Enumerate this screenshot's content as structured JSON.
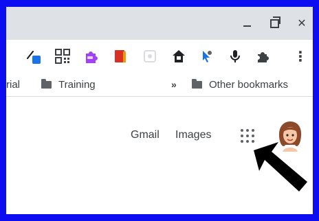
{
  "window": {
    "controls": [
      {
        "name": "minimize-icon"
      },
      {
        "name": "restore-icon"
      },
      {
        "name": "close-icon",
        "glyph": "✕"
      }
    ]
  },
  "toolbar": {
    "extensions": [
      "color-picker-icon",
      "qr-code-icon",
      "puzzle-extension-icon",
      "red-book-icon",
      "grey-extension-icon",
      "house-extension-icon",
      "cursor-extension-icon",
      "microphone-icon",
      "extensions-puzzle-icon",
      "more-menu-icon"
    ],
    "more_glyph": "⋮"
  },
  "bookmarks": {
    "partial_left": "rial",
    "items": [
      {
        "label": "Training"
      }
    ],
    "overflow_glyph": "»",
    "other": "Other bookmarks"
  },
  "google_header": {
    "gmail": "Gmail",
    "images": "Images"
  },
  "colors": {
    "frame_border": "#0d0df2",
    "titlebar": "#dee1e6",
    "text": "#3c4043",
    "icon_grey": "#5f6368"
  }
}
